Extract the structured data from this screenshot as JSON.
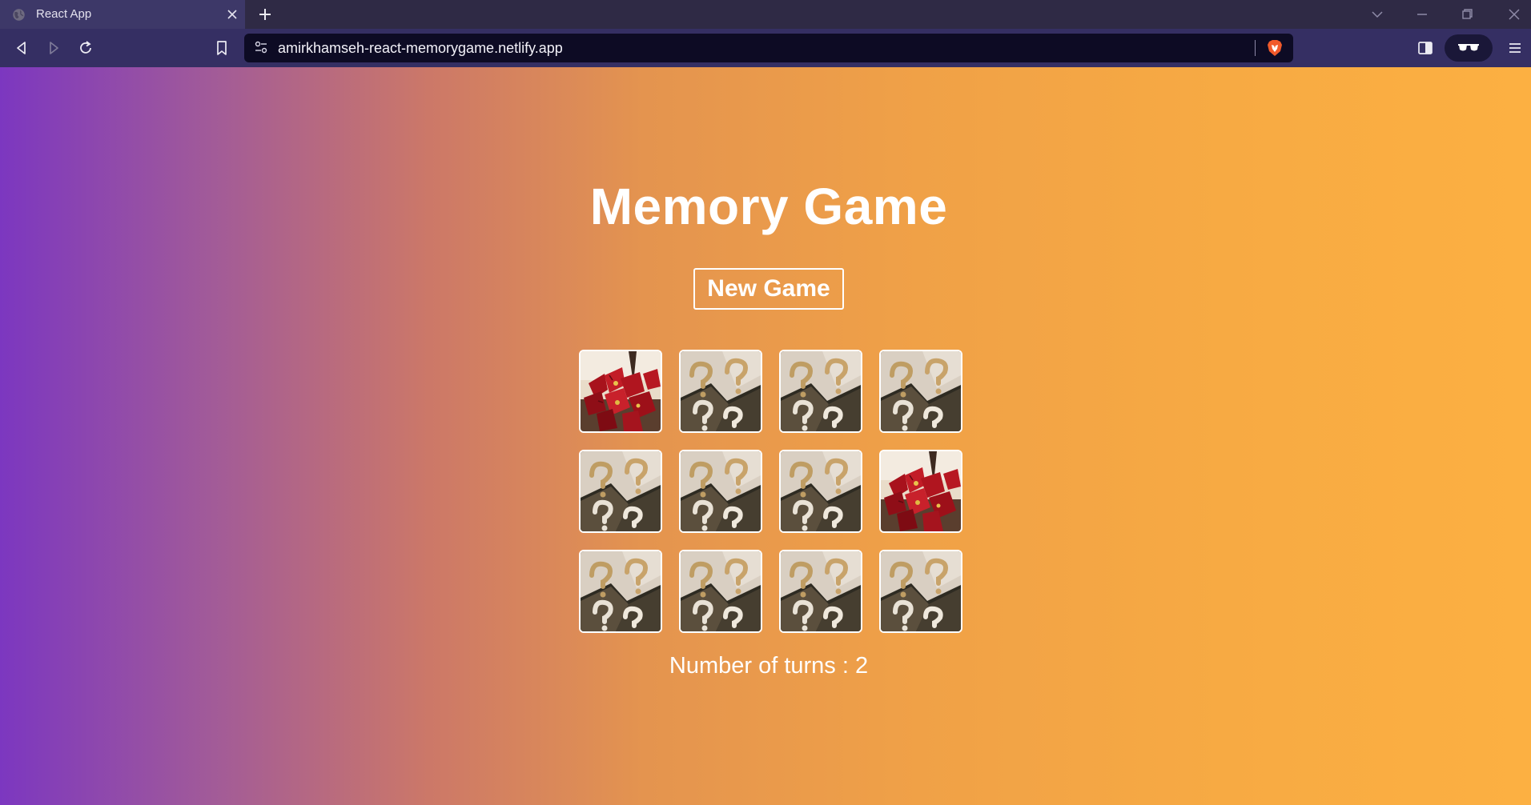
{
  "browser": {
    "tab_title": "React App",
    "url": "amirkhamseh-react-memorygame.netlify.app",
    "icons": [
      "globe-icon",
      "close-icon",
      "plus-icon",
      "chevron-down-icon",
      "minimize-icon",
      "restore-icon",
      "back-icon",
      "forward-icon",
      "reload-icon",
      "bookmark-icon",
      "site-settings-icon",
      "brave-shield-icon",
      "sidebar-icon",
      "private-glasses-icon",
      "menu-icon"
    ]
  },
  "game": {
    "title": "Memory Game",
    "new_game_label": "New Game",
    "turns_text": "Number of turns : 2",
    "cards": [
      {
        "state": "flipped",
        "image": "red-flowers"
      },
      {
        "state": "hidden",
        "image": "question-marks"
      },
      {
        "state": "hidden",
        "image": "question-marks"
      },
      {
        "state": "hidden",
        "image": "question-marks"
      },
      {
        "state": "hidden",
        "image": "question-marks"
      },
      {
        "state": "hidden",
        "image": "question-marks"
      },
      {
        "state": "hidden",
        "image": "question-marks"
      },
      {
        "state": "flipped",
        "image": "red-flowers"
      },
      {
        "state": "hidden",
        "image": "question-marks"
      },
      {
        "state": "hidden",
        "image": "question-marks"
      },
      {
        "state": "hidden",
        "image": "question-marks"
      },
      {
        "state": "hidden",
        "image": "question-marks"
      }
    ]
  },
  "colors": {
    "gradient_start": "#7c37c0",
    "gradient_end": "#fcb042",
    "text": "#ffffff",
    "tabbar": "#2f2a45",
    "toolbar": "#352f63"
  }
}
